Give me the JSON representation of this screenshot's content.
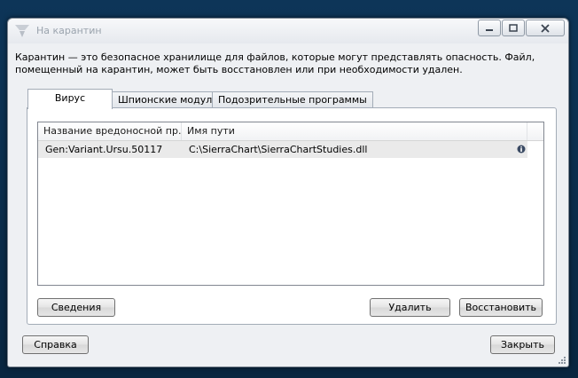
{
  "window": {
    "title": "На карантин",
    "controls": {
      "minimize_icon": "minimize-icon",
      "maximize_icon": "maximize-icon",
      "close_icon": "close-icon"
    }
  },
  "description": "Карантин — это безопасное хранилище для файлов, которые могут представлять опасность. Файл, помещенный на карантин, может быть восстановлен или при необходимости удален.",
  "tabs": [
    {
      "label": "Вирус",
      "active": true
    },
    {
      "label": "Шпионские модули",
      "active": false
    },
    {
      "label": "Подозрительные программы",
      "active": false
    }
  ],
  "table": {
    "columns": [
      "Название вредоносной пр...",
      "Имя пути"
    ],
    "rows": [
      {
        "name": "Gen:Variant.Ursu.50117",
        "path": "C:\\SierraChart\\SierraChartStudies.dll",
        "icon": "info-icon"
      }
    ]
  },
  "buttons": {
    "details": "Сведения",
    "delete": "Удалить",
    "restore": "Восстановить",
    "help": "Справка",
    "close": "Закрыть"
  },
  "colors": {
    "desktop": "#0b2a45",
    "window_bg": "#eef0f3",
    "selected_row": "#eaeaea"
  }
}
